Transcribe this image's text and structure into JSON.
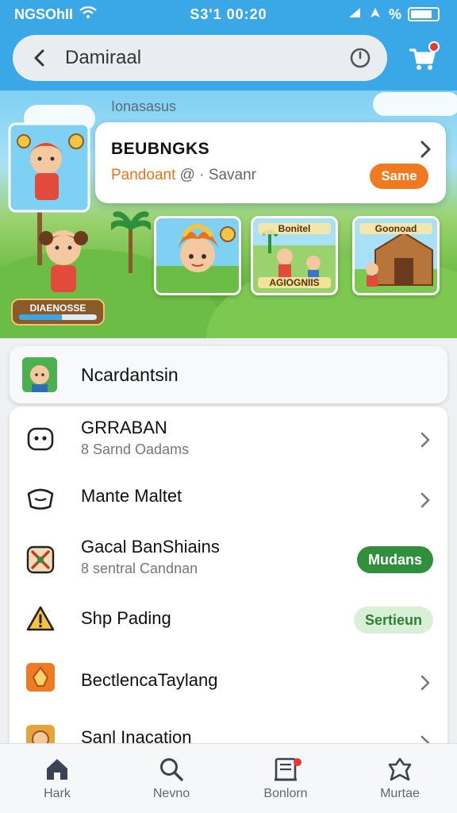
{
  "status_bar": {
    "carrier": "NGSOhII",
    "time": "S3'1 00:20",
    "right_text": "%"
  },
  "search": {
    "value": "Damiraal"
  },
  "banner": {
    "section_label": "Ionasasus",
    "feature": {
      "title": "BEUBNGKS",
      "sub_orange": "Pandoant",
      "sub_gray": "@ · Savanr",
      "button": "Same"
    },
    "thumbs": [
      {
        "label": ""
      },
      {
        "top_label": "Bonitel",
        "bottom_label": "AGIOGNIIS"
      },
      {
        "top_label": "Goonoad"
      }
    ],
    "hero_badge": "DIAENOSSE",
    "hero_progress": 0.55
  },
  "highlight": {
    "label": "Ncardantsin"
  },
  "list": [
    {
      "title": "GRRABAN",
      "subtitle": "8 Sarnd Oadams",
      "trailing": "chevron"
    },
    {
      "title": "Mante Maltet",
      "subtitle": "",
      "trailing": "chevron"
    },
    {
      "title": "Gacal BanShiains",
      "subtitle": "8 sentral Candnan",
      "trailing": "pill",
      "pill": "Mudans"
    },
    {
      "title": "Shp Pading",
      "subtitle": "",
      "trailing": "pill",
      "pill": "Sertieun"
    },
    {
      "title": "BectlencaTaylang",
      "subtitle": "",
      "trailing": "chevron"
    },
    {
      "title": "Sanl Inacation",
      "subtitle": "",
      "trailing": "chevron"
    }
  ],
  "bottom_nav": [
    {
      "label": "Hark",
      "icon": "home-icon"
    },
    {
      "label": "Nevno",
      "icon": "search-icon"
    },
    {
      "label": "Bonlorn",
      "icon": "inbox-icon"
    },
    {
      "label": "Murtae",
      "icon": "profile-icon"
    }
  ],
  "colors": {
    "accent": "#3aa7e6",
    "orange": "#f07a22",
    "green": "#2f8f3a"
  }
}
